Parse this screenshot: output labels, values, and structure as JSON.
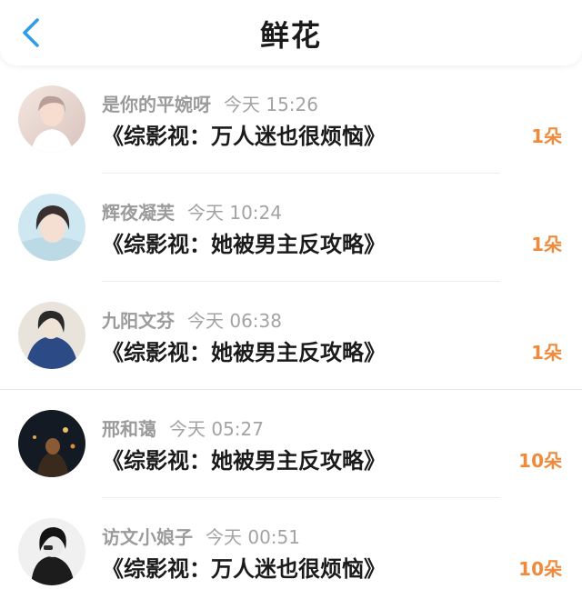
{
  "header": {
    "title": "鲜花",
    "accent_color": "#2f9de8"
  },
  "items": [
    {
      "user": "是你的平婉呀",
      "time": "今天 15:26",
      "book": "《综影视：万人迷也很烦恼》",
      "count": "1朵"
    },
    {
      "user": "辉夜凝芙",
      "time": "今天 10:24",
      "book": "《综影视：她被男主反攻略》",
      "count": "1朵"
    },
    {
      "user": "九阳文芬",
      "time": "今天 06:38",
      "book": "《综影视：她被男主反攻略》",
      "count": "1朵"
    },
    {
      "user": "邢和蔼",
      "time": "今天 05:27",
      "book": "《综影视：她被男主反攻略》",
      "count": "10朵"
    },
    {
      "user": "访文小娘子",
      "time": "今天 00:51",
      "book": "《综影视：万人迷也很烦恼》",
      "count": "10朵"
    }
  ],
  "colors": {
    "count_color": "#f08a3a",
    "meta_color": "#9a9a9a"
  }
}
